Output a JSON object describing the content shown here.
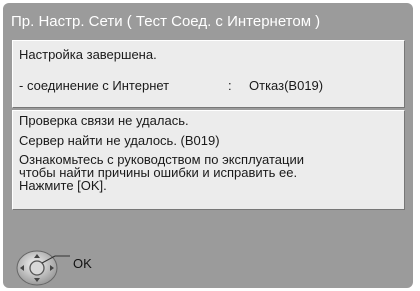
{
  "dialog": {
    "title": "Пр. Настр. Сети ( Тест Соед. с Интернетом )",
    "status": "Настройка завершена.",
    "connection_label": "- соединение с Интернет",
    "connection_separator": ":",
    "connection_value": "Отказ(B019)",
    "check_failed": "Проверка связи не удалась.",
    "server_not_found": "Сервер найти не удалось. (B019)",
    "instructions": [
      "Ознакомьтесь с руководством по эксплуатации",
      "чтобы найти причины ошибки и исправить ее.",
      "Нажмите [OK]."
    ]
  },
  "footer": {
    "ok_label": "OK",
    "icon": "remote-dpad-icon"
  },
  "colors": {
    "panel": "#9b9b9b",
    "box": "#ececec",
    "title_text": "#ffffff",
    "body_text": "#1a1a1a"
  }
}
